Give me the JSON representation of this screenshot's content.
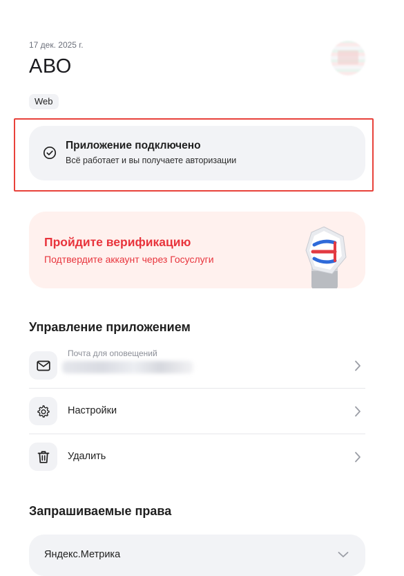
{
  "header": {
    "date": "17 дек. 2025 г.",
    "app_name": "АВО",
    "platform": "Web"
  },
  "status": {
    "title": "Приложение подключено",
    "subtitle": "Всё работает и вы получаете авторизации"
  },
  "verification": {
    "title": "Пройдите верификацию",
    "subtitle": "Подтвердите аккаунт через Госуслуги"
  },
  "management": {
    "heading": "Управление приложением",
    "items": [
      {
        "caption": "Почта для оповещений",
        "icon": "mail-icon"
      },
      {
        "label": "Настройки",
        "icon": "gear-icon"
      },
      {
        "label": "Удалить",
        "icon": "trash-icon"
      }
    ]
  },
  "rights": {
    "heading": "Запрашиваемые права",
    "selected": "Яндекс.Метрика"
  },
  "colors": {
    "accent_red": "#e8343c",
    "verify_bg": "#fff1ee",
    "card_bg": "#f2f3f6",
    "highlight_border": "#e8413a"
  }
}
